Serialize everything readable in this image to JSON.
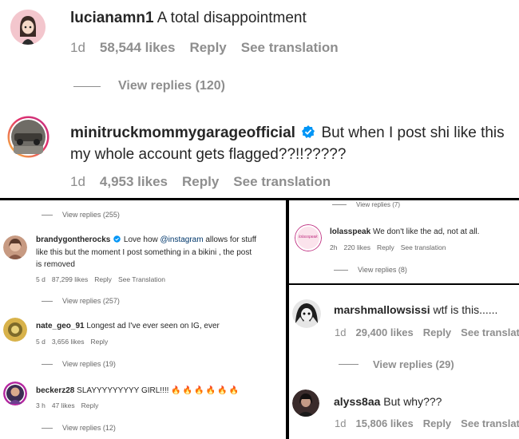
{
  "top": {
    "c1": {
      "user": "lucianamn1",
      "text": "A total disappointment",
      "time": "1d",
      "likes": "58,544 likes",
      "reply": "Reply",
      "translate": "See translation",
      "view_replies": "View replies (120)"
    },
    "c2": {
      "user": "minitruckmommygarageofficial",
      "line1": "But when I post shi like this",
      "line2": "my whole account gets flagged??!!?????",
      "time": "1d",
      "likes": "4,953 likes",
      "reply": "Reply",
      "translate": "See translation"
    }
  },
  "left": {
    "view1": "View replies (255)",
    "c1": {
      "user": "brandygontherocks",
      "pre": "Love how ",
      "mention": "@instagram",
      "post": " allows for stuff",
      "line2": "like this but the moment I post something in a bikini , the post",
      "line3": "is removed",
      "time": "5 d",
      "likes": "87,299 likes",
      "reply": "Reply",
      "translate": "See Translation"
    },
    "view2": "View replies (257)",
    "c2": {
      "user": "nate_geo_91",
      "text": "Longest ad I've ever seen on IG, ever",
      "time": "5 d",
      "likes": "3,656 likes",
      "reply": "Reply"
    },
    "view3": "View replies (19)",
    "c3": {
      "user": "beckerz28",
      "text": "SLAYYYYYYYYY GIRL!!!!",
      "emoji": "🔥🔥🔥🔥🔥🔥",
      "time": "3 h",
      "likes": "47 likes",
      "reply": "Reply"
    },
    "view4": "View replies (12)"
  },
  "mid": {
    "view0": "View replies (7)",
    "c1": {
      "user": "lolasspeak",
      "text": "We don't like the ad, not at all.",
      "avatar_text": "lolasspeak",
      "time": "2h",
      "likes": "220 likes",
      "reply": "Reply",
      "translate": "See translation"
    },
    "view1": "View replies (8)"
  },
  "br": {
    "c1": {
      "user": "marshmallowsissi",
      "text": "wtf is this......",
      "time": "1d",
      "likes": "29,400 likes",
      "reply": "Reply",
      "translate": "See translat"
    },
    "view1": "View replies (29)",
    "c2": {
      "user": "alyss8aa",
      "text": "But why???",
      "time": "1d",
      "likes": "15,806 likes",
      "reply": "Reply",
      "translate": "See translat"
    }
  },
  "colors": {
    "verified": "#0095f6",
    "muted": "#8e8e8e",
    "text": "#262626",
    "mention": "#00376b"
  },
  "icons": [
    "verified-badge-icon",
    "fire-emoji"
  ]
}
